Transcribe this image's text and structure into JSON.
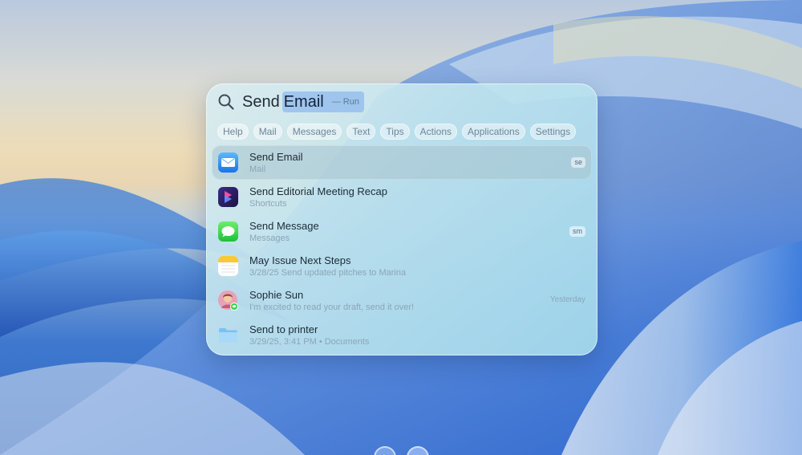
{
  "search": {
    "typed": "Send",
    "completion": "Email",
    "completion_action": "— Run"
  },
  "chips": [
    "Help",
    "Mail",
    "Messages",
    "Text",
    "Tips",
    "Actions",
    "Applications",
    "Settings"
  ],
  "results": [
    {
      "title": "Send Email",
      "subtitle": "Mail",
      "badge": "se",
      "icon": "mail-icon",
      "selected": true
    },
    {
      "title": "Send Editorial Meeting Recap",
      "subtitle": "Shortcuts",
      "icon": "shortcuts-icon"
    },
    {
      "title": "Send Message",
      "subtitle": "Messages",
      "badge": "sm",
      "icon": "messages-icon"
    },
    {
      "title": "May Issue Next Steps",
      "subtitle": "3/28/25 Send updated pitches to Marina",
      "icon": "notes-icon"
    },
    {
      "title": "Sophie Sun",
      "subtitle": "I'm excited to read your draft, send it over!",
      "timestamp": "Yesterday",
      "icon": "contact-avatar-icon"
    },
    {
      "title": "Send to printer",
      "subtitle": "3/29/25, 3:41 PM • Documents",
      "icon": "folder-icon"
    }
  ],
  "colors": {
    "selection_highlight": "#a5c3cd",
    "completion_highlight": "#78aaf0",
    "wallpaper_blue": "#2f63c0"
  }
}
